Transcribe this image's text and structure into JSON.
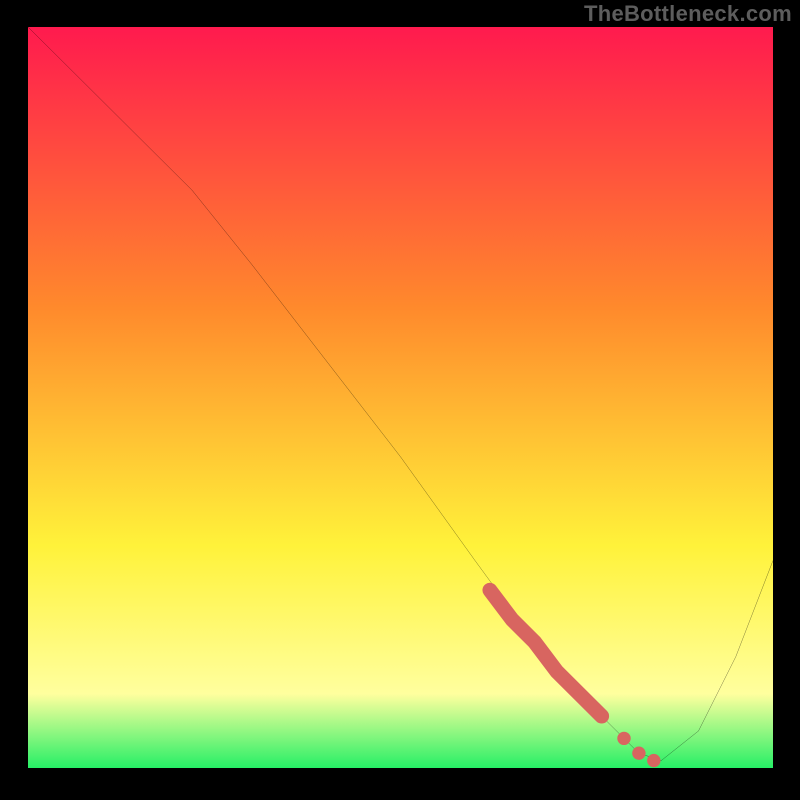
{
  "watermark": "TheBottleneck.com",
  "colors": {
    "frame": "#000000",
    "grad_top": "#ff1a4e",
    "grad_mid1": "#ff8a2c",
    "grad_mid2": "#fff23a",
    "grad_low": "#ffff9e",
    "grad_base": "#26ef66",
    "curve": "#000000",
    "marker": "#d86560"
  },
  "chart_data": {
    "type": "line",
    "title": "",
    "xlabel": "",
    "ylabel": "",
    "xlim": [
      0,
      100
    ],
    "ylim": [
      0,
      100
    ],
    "series": [
      {
        "name": "bottleneck-curve",
        "x": [
          0,
          10,
          22,
          30,
          40,
          50,
          60,
          68,
          74,
          78,
          82,
          85,
          90,
          95,
          100
        ],
        "y": [
          100,
          90,
          78,
          68,
          55,
          42,
          28,
          17,
          10,
          6,
          2,
          1,
          5,
          15,
          28
        ]
      }
    ],
    "highlight_segment": {
      "name": "highlighted-range",
      "x": [
        62,
        65,
        68,
        71,
        74,
        77,
        80,
        82,
        84
      ],
      "y": [
        24,
        20,
        17,
        13,
        10,
        7,
        4,
        2,
        1
      ]
    },
    "annotations": []
  }
}
